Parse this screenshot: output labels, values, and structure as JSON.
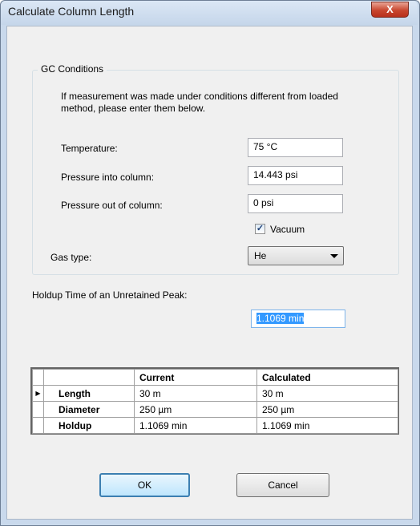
{
  "window": {
    "title": "Calculate Column Length",
    "close_label": "X"
  },
  "gc": {
    "group_title": "GC Conditions",
    "info_line1": "If measurement was made under conditions different from loaded",
    "info_line2": "method, please enter them below.",
    "temperature_label": "Temperature:",
    "temperature_value": "75 °C",
    "pressure_in_label": "Pressure into column:",
    "pressure_in_value": "14.443 psi",
    "pressure_out_label": "Pressure out of column:",
    "pressure_out_value": "0 psi",
    "vacuum_label": "Vacuum",
    "vacuum_checked": true,
    "gas_label": "Gas type:",
    "gas_value": "He"
  },
  "holdup": {
    "label": "Holdup Time of an Unretained Peak:",
    "value": "1.1069 min"
  },
  "grid": {
    "headers": [
      "",
      "Current",
      "Calculated"
    ],
    "rows": [
      {
        "label": "Length",
        "current": "30 m",
        "calculated": "30 m",
        "marker": "▶"
      },
      {
        "label": "Diameter",
        "current": "250 µm",
        "calculated": "250 µm",
        "marker": ""
      },
      {
        "label": "Holdup",
        "current": "1.1069 min",
        "calculated": "1.1069 min",
        "marker": ""
      }
    ]
  },
  "buttons": {
    "ok": "OK",
    "cancel": "Cancel"
  }
}
